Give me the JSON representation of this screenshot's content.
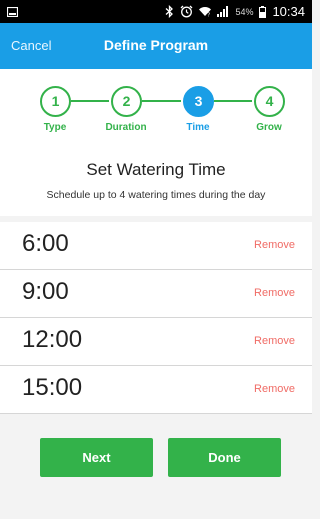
{
  "status_bar": {
    "battery_percent": "54%",
    "clock": "10:34",
    "icons": [
      "notification-icon",
      "bluetooth-icon",
      "alarm-icon",
      "wifi-icon",
      "signal-icon",
      "battery-icon"
    ]
  },
  "header": {
    "cancel_label": "Cancel",
    "title": "Define Program"
  },
  "steps": [
    {
      "number": "1",
      "label": "Type"
    },
    {
      "number": "2",
      "label": "Duration"
    },
    {
      "number": "3",
      "label": "Time"
    },
    {
      "number": "4",
      "label": "Grow"
    }
  ],
  "section": {
    "title": "Set Watering Time",
    "subtitle": "Schedule up to 4 watering times during the day"
  },
  "times": [
    {
      "time": "6:00",
      "action": "Remove"
    },
    {
      "time": "9:00",
      "action": "Remove"
    },
    {
      "time": "12:00",
      "action": "Remove"
    },
    {
      "time": "15:00",
      "action": "Remove"
    }
  ],
  "buttons": {
    "next": "Next",
    "done": "Done"
  },
  "colors": {
    "primary_blue": "#1a9ee6",
    "green": "#33b24a",
    "remove_red": "#f06b65"
  }
}
